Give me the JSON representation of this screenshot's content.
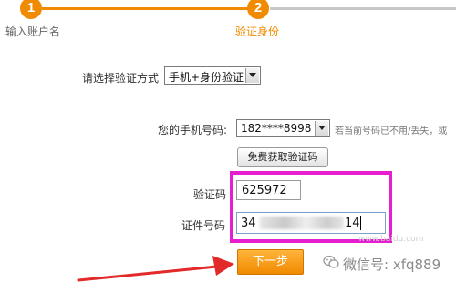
{
  "steps": [
    {
      "number": "1",
      "label": "输入账户名",
      "state": "completed"
    },
    {
      "number": "2",
      "label": "验证身份",
      "state": "active"
    }
  ],
  "verify_method": {
    "label": "请选择验证方式",
    "selected": "手机+身份验证"
  },
  "phone": {
    "label": "您的手机号码:",
    "selected": "182****8998",
    "hint": "若当前号码已不用/丢失，或"
  },
  "get_code_button": {
    "label": "免费获取验证码"
  },
  "code": {
    "label": "验证码",
    "value": "625972"
  },
  "id_number": {
    "label": "证件号码",
    "value_prefix": "34",
    "value_suffix": "14"
  },
  "next_button": {
    "label": "下一步"
  },
  "watermark": {
    "text": "微信号: xfq889",
    "faint_text": "www.baidu.com"
  },
  "colors": {
    "accent": "#f08a00",
    "highlight": "#e51fd0",
    "arrow": "#e32a2a"
  }
}
